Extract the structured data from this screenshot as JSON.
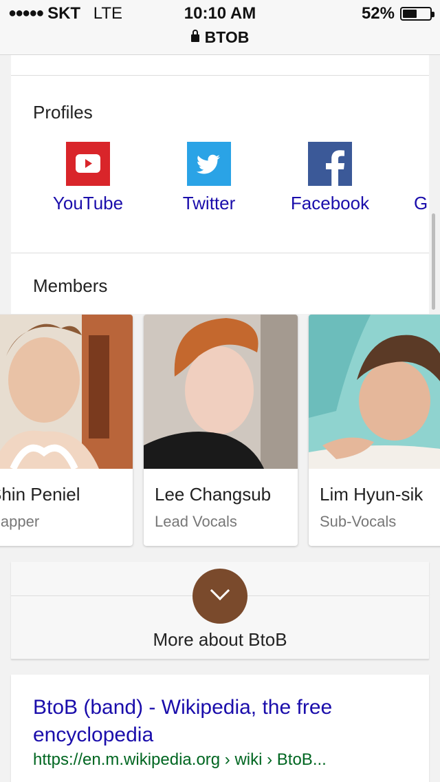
{
  "status_bar": {
    "signal": "●●●●●",
    "carrier": "SKT",
    "network": "LTE",
    "time": "10:10 AM",
    "battery_percent": "52%",
    "battery_level": 0.52,
    "url_label": "BTOB"
  },
  "profiles": {
    "title": "Profiles",
    "items": [
      {
        "label": "YouTube",
        "icon": "youtube-icon",
        "color": "#e52d27"
      },
      {
        "label": "Twitter",
        "icon": "twitter-icon",
        "color": "#1da1f2"
      },
      {
        "label": "Facebook",
        "icon": "facebook-icon",
        "color": "#3b5998"
      },
      {
        "label": "G",
        "icon": "google-plus-icon"
      }
    ]
  },
  "members": {
    "title": "Members",
    "items": [
      {
        "name": "Shin Peniel",
        "role": "Rapper"
      },
      {
        "name": "Lee Changsub",
        "role": "Lead Vocals"
      },
      {
        "name": "Lim Hyun-sik",
        "role": "Sub-Vocals"
      }
    ]
  },
  "more": {
    "label": "More about BtoB",
    "button_color": "#7a4a2c"
  },
  "result": {
    "title": "BtoB (band) - Wikipedia, the free encyclopedia",
    "url": "https://en.m.wikipedia.org › wiki › BtoB..."
  },
  "colors": {
    "link": "#1a0dab",
    "url_green": "#006621"
  }
}
